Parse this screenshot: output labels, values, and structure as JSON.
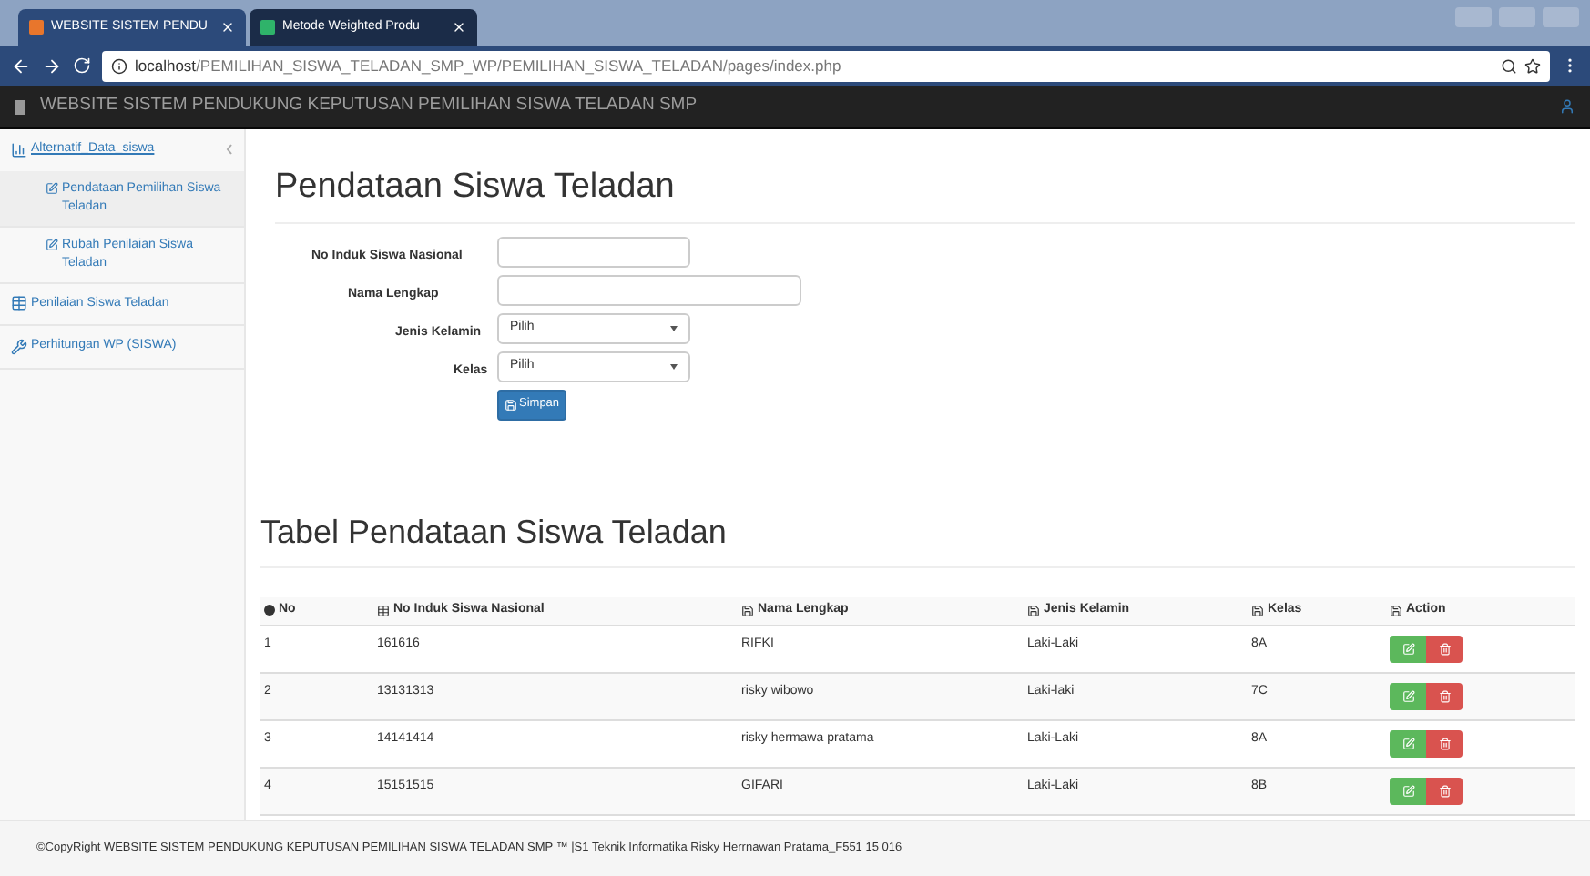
{
  "browser": {
    "tabs": [
      {
        "title": "WEBSITE SISTEM PENDU",
        "selected": true
      },
      {
        "title": "Metode Weighted Produ",
        "selected": false
      }
    ],
    "address": {
      "host": "localhost",
      "path": "/PEMILIHAN_SISWA_TELADAN_SMP_WP/PEMILIHAN_SISWA_TELADAN/pages/index.php"
    }
  },
  "navbar": {
    "title": "WEBSITE SISTEM PENDUKUNG KEPUTUSAN PEMILIHAN SISWA TELADAN SMP"
  },
  "sidebar": {
    "items": [
      {
        "label": "Alternatif_Data_siswa",
        "expanded": true,
        "children": [
          {
            "label": "Pendataan Pemilihan Siswa Teladan",
            "selected": true
          },
          {
            "label": "Rubah Penilaian Siswa Teladan",
            "selected": false
          }
        ]
      },
      {
        "label": "Penilaian Siswa Teladan"
      },
      {
        "label": "Perhitungan WP (SISWA)"
      }
    ]
  },
  "form": {
    "title": "Pendataan Siswa Teladan",
    "fields": [
      {
        "label": "No Induk Siswa Nasional",
        "kind": "text"
      },
      {
        "label": "Nama Lengkap",
        "kind": "text-wide"
      },
      {
        "label": "Jenis Kelamin",
        "kind": "select",
        "value": "Pilih"
      },
      {
        "label": "Kelas",
        "kind": "select",
        "value": "Pilih"
      }
    ],
    "submit": "Simpan"
  },
  "table": {
    "title": "Tabel Pendataan Siswa Teladan",
    "columns": [
      "No",
      "No Induk Siswa Nasional",
      "Nama Lengkap",
      "Jenis Kelamin",
      "Kelas",
      "Action"
    ],
    "rows": [
      [
        "1",
        "161616",
        "RIFKI",
        "Laki-Laki",
        "8A"
      ],
      [
        "2",
        "13131313",
        "risky wibowo",
        "Laki-laki",
        "7C"
      ],
      [
        "3",
        "14141414",
        "risky hermawa pratama",
        "Laki-Laki",
        "8A"
      ],
      [
        "4",
        "15151515",
        "GIFARI",
        "Laki-Laki",
        "8B"
      ]
    ]
  },
  "footer": "©CopyRight WEBSITE SISTEM PENDUKUNG KEPUTUSAN PEMILIHAN SISWA TELADAN SMP ™ |S1 Teknik Informatika Risky Herrnawan Pratama_F551 15 016"
}
